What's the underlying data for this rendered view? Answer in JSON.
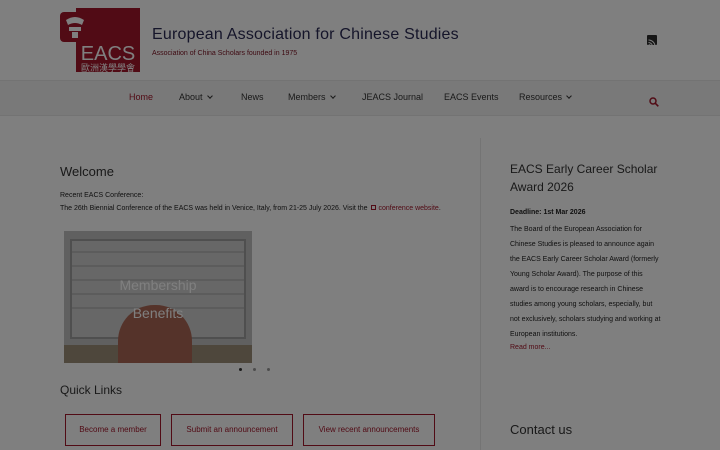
{
  "site": {
    "title": "European Association for Chinese Studies",
    "tagline": "Association of China Scholars founded in 1975",
    "logo_text": "EACS",
    "logo_chinese": "歐洲漢學學會"
  },
  "nav": {
    "items": [
      {
        "label": "Home"
      },
      {
        "label": "About"
      },
      {
        "label": "News"
      },
      {
        "label": "Members"
      },
      {
        "label": "JEACS Journal"
      },
      {
        "label": "EACS Events"
      },
      {
        "label": "Resources"
      }
    ]
  },
  "main": {
    "welcome": "Welcome",
    "conf_label": "Recent EACS Conference:",
    "conf_text": "The 26th Biennial Conference of the EACS was held in Venice, Italy, from 21-25 July 2026. Visit the",
    "conf_link": "conference website",
    "conf_end": ".",
    "slide_caption_line1": "Membership",
    "slide_caption_line2": "Benefits",
    "quick_links_title": "Quick Links",
    "quick_links": [
      {
        "label": "Become a member"
      },
      {
        "label": "Submit an announcement"
      },
      {
        "label": "View recent announcements"
      }
    ]
  },
  "sidebar": {
    "award_title": "EACS Early Career Scholar Award 2026",
    "deadline": "Deadline: 1st Mar 2026",
    "body": "The Board of the European Association for Chinese Studies is pleased to announce again the EACS Early Career Scholar Award (formerly Young Scholar Award). The purpose of this award is to encourage research in Chinese studies among young scholars, especially, but not exclusively, scholars studying and working at European institutions.",
    "read_more": "Read more...",
    "contact_title": "Contact us"
  },
  "colors": {
    "accent": "#a3162a",
    "title": "#2b2b55",
    "overlay": "rgba(0,0,0,0.5)"
  }
}
